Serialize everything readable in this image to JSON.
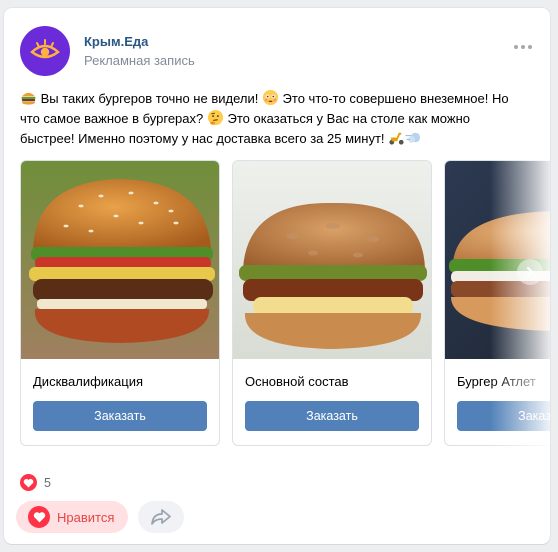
{
  "post": {
    "group_name": "Крым.Еда",
    "ad_label": "Рекламная запись",
    "text": {
      "part1": " Вы таких бургеров точно не видели! ",
      "part2": " Это что-то совершено внеземное! Но что самое важное в бургерах? ",
      "part3": " Это оказаться у Вас на столе как можно быстрее! Именно поэтому у нас доставка всего за 25 минут! "
    }
  },
  "carousel": {
    "cards": [
      {
        "title": "Дисквалификация",
        "button": "Заказать"
      },
      {
        "title": "Основной состав",
        "button": "Заказать"
      },
      {
        "title": "Бургер Атлет",
        "button": "Заказать"
      }
    ]
  },
  "reactions": {
    "likes_count": "5",
    "like_label": "Нравится"
  },
  "colors": {
    "brand_avatar": "#6b2bd8",
    "link": "#2a5885",
    "button": "#5181b8",
    "like": "#ff3347"
  },
  "icons": {
    "avatar": "eye-logo-icon",
    "more": "more-dots-icon",
    "emoji1": "burger-emoji",
    "emoji2": "flushed-face-emoji",
    "emoji3": "thinking-face-emoji",
    "emoji4": "scooter-emoji",
    "emoji5": "dash-emoji",
    "next": "chevron-right-icon",
    "like": "heart-icon",
    "share": "share-arrow-icon"
  }
}
